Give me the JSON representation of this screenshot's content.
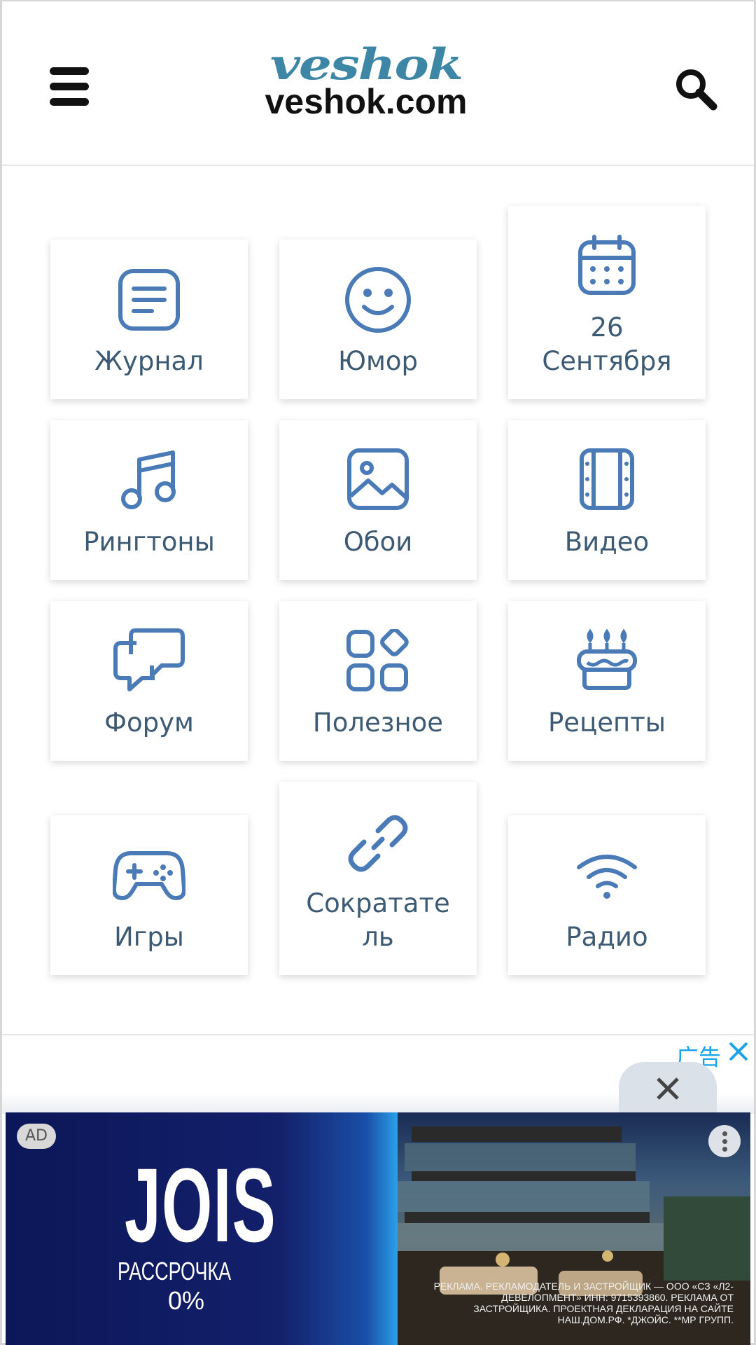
{
  "header": {
    "logo_top": "veshok",
    "logo_bottom": "veshok.com"
  },
  "tiles": [
    {
      "label": "Журнал",
      "icon": "journal-icon"
    },
    {
      "label": "Юмор",
      "icon": "smile-icon"
    },
    {
      "label_day": "26",
      "label": "Сентября",
      "icon": "calendar-icon"
    },
    {
      "label": "Рингтоны",
      "icon": "music-note-icon"
    },
    {
      "label": "Обои",
      "icon": "image-icon"
    },
    {
      "label": "Видео",
      "icon": "film-icon"
    },
    {
      "label": "Форум",
      "icon": "chat-bubbles-icon"
    },
    {
      "label": "Полезное",
      "icon": "apps-icon"
    },
    {
      "label": "Рецепты",
      "icon": "cake-icon"
    },
    {
      "label": "Игры",
      "icon": "gamepad-icon"
    },
    {
      "label_line1": "Сократате",
      "label_line2": "ль",
      "icon": "link-icon"
    },
    {
      "label": "Радио",
      "icon": "wifi-icon"
    }
  ],
  "ad": {
    "tag": "广告",
    "badge": "AD",
    "brand": "JOIS",
    "sub1": "РАССРОЧКА",
    "sub2": "0%",
    "legal": "РЕКЛАМА. РЕКЛАМОДАТЕЛЬ И ЗАСТРОЙЩИК — ООО «СЗ «Л2-ДЕВЕЛОПМЕНТ» ИНН: 9715393860. РЕКЛАМА ОТ ЗАСТРОЙЩИКА. ПРОЕКТНАЯ ДЕКЛАРАЦИЯ НА САЙТЕ НАШ.ДОМ.РФ. *ДЖОЙС. **МР ГРУПП."
  },
  "colors": {
    "icon": "#4a7bb7",
    "label": "#3c5a74",
    "logo_top": "#3d86a6",
    "ad_tag": "#1aa3e8"
  }
}
